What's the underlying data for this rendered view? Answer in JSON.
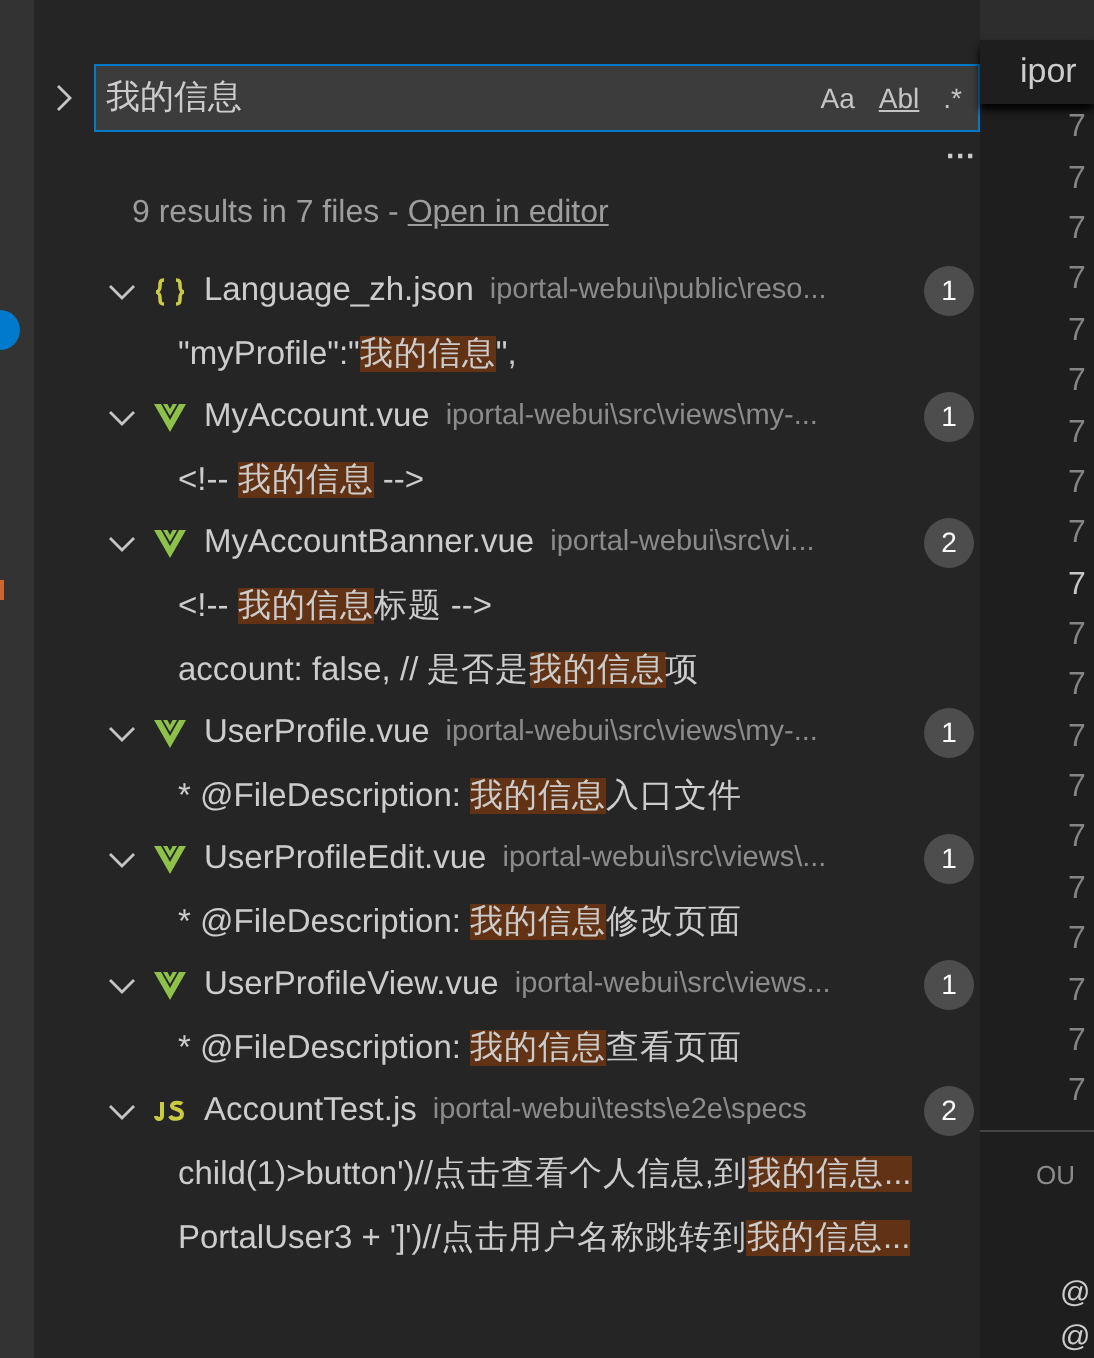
{
  "search": {
    "value": "我的信息",
    "options": [
      {
        "label": "Aa",
        "selected": false
      },
      {
        "label": "Abl",
        "selected": false
      },
      {
        "label": ".*",
        "selected": false
      }
    ],
    "more": "···"
  },
  "summary": {
    "text": "9 results in 7 files - ",
    "link": "Open in editor"
  },
  "files": [
    {
      "name": "Language_zh.json",
      "path": "iportal-webui\\public\\reso...",
      "count": "1",
      "kind": "json",
      "expanded": true,
      "matches": [
        {
          "before": "\"myProfile\":\"",
          "match": "我的信息",
          "after": "\","
        }
      ]
    },
    {
      "name": "MyAccount.vue",
      "path": "iportal-webui\\src\\views\\my-...",
      "count": "1",
      "kind": "vue",
      "expanded": true,
      "matches": [
        {
          "before": "<!-- ",
          "match": "我的信息",
          "after": " -->"
        }
      ]
    },
    {
      "name": "MyAccountBanner.vue",
      "path": "iportal-webui\\src\\vi...",
      "count": "2",
      "kind": "vue",
      "expanded": true,
      "matches": [
        {
          "before": "<!-- ",
          "match": "我的信息",
          "after": "标题 -->"
        },
        {
          "before": "account: false, // 是否是",
          "match": "我的信息",
          "after": "项"
        }
      ]
    },
    {
      "name": "UserProfile.vue",
      "path": "iportal-webui\\src\\views\\my-...",
      "count": "1",
      "kind": "vue",
      "expanded": true,
      "matches": [
        {
          "before": "* @FileDescription: ",
          "match": "我的信息",
          "after": "入口文件"
        }
      ]
    },
    {
      "name": "UserProfileEdit.vue",
      "path": "iportal-webui\\src\\views\\...",
      "count": "1",
      "kind": "vue",
      "expanded": true,
      "matches": [
        {
          "before": "* @FileDescription: ",
          "match": "我的信息",
          "after": "修改页面"
        }
      ]
    },
    {
      "name": "UserProfileView.vue",
      "path": "iportal-webui\\src\\views...",
      "count": "1",
      "kind": "vue",
      "expanded": true,
      "matches": [
        {
          "before": "* @FileDescription: ",
          "match": "我的信息",
          "after": "查看页面"
        }
      ]
    },
    {
      "name": "AccountTest.js",
      "path": "iportal-webui\\tests\\e2e\\specs",
      "count": "2",
      "kind": "js",
      "expanded": true,
      "matches": [
        {
          "before": "child(1)>button')//点击查看个人信息,到",
          "match": "我的信息..."
        },
        {
          "before": "PortalUser3 + ']')//点击用户名称跳转到",
          "match": "我的信息..."
        }
      ]
    }
  ],
  "editor": {
    "tab": "ipor",
    "line_numbers": [
      "7",
      "7",
      "7",
      "7",
      "7",
      "7",
      "7",
      "7",
      "7",
      "7",
      "7",
      "7",
      "7",
      "7",
      "7",
      "7",
      "7",
      "7",
      "7",
      "7"
    ],
    "panel_title": "OU",
    "panel_lines": [
      "@",
      "@"
    ]
  }
}
